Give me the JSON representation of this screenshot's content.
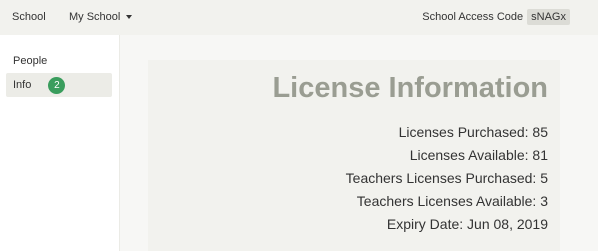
{
  "topbar": {
    "brand": "School",
    "menu_label": "My School",
    "access_label": "School Access Code",
    "access_code": "sNAGx"
  },
  "sidebar": {
    "items": [
      {
        "label": "People"
      },
      {
        "label": "Info",
        "badge": "2"
      }
    ]
  },
  "license": {
    "title": "License Information",
    "lines": [
      "Licenses Purchased: 85",
      "Licenses Available: 81",
      "Teachers Licenses Purchased: 5",
      "Teachers Licenses Available: 3",
      "Expiry Date: Jun 08, 2019"
    ]
  }
}
